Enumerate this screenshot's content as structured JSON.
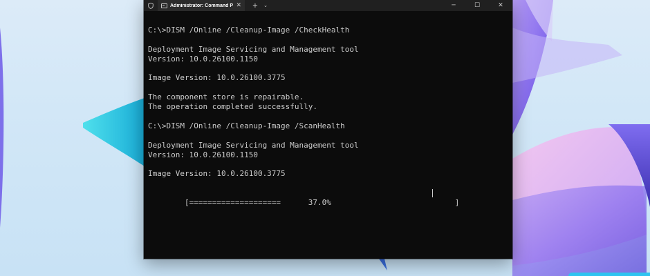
{
  "window": {
    "tab_title": "Administrator: Command Pro",
    "tab_close": "✕",
    "new_tab": "+",
    "dropdown": "⌄",
    "minimize": "─",
    "maximize": "☐",
    "close": "✕"
  },
  "console": {
    "lines": [
      "C:\\>DISM /Online /Cleanup-Image /CheckHealth",
      "",
      "Deployment Image Servicing and Management tool",
      "Version: 10.0.26100.1150",
      "",
      "Image Version: 10.0.26100.3775",
      "",
      "The component store is repairable.",
      "The operation completed successfully.",
      "",
      "C:\\>DISM /Online /Cleanup-Image /ScanHealth",
      "",
      "Deployment Image Servicing and Management tool",
      "Version: 10.0.26100.1150",
      "",
      "Image Version: 10.0.26100.3775",
      "",
      "[====================      37.0%                           ]"
    ],
    "progress_percent": 37.0
  },
  "colors": {
    "console_bg": "#0c0c0c",
    "console_text": "#cccccc",
    "titlebar_bg": "#202020",
    "tab_bg": "#2b2b2b",
    "accent_cyan": "#2ec4f0"
  }
}
